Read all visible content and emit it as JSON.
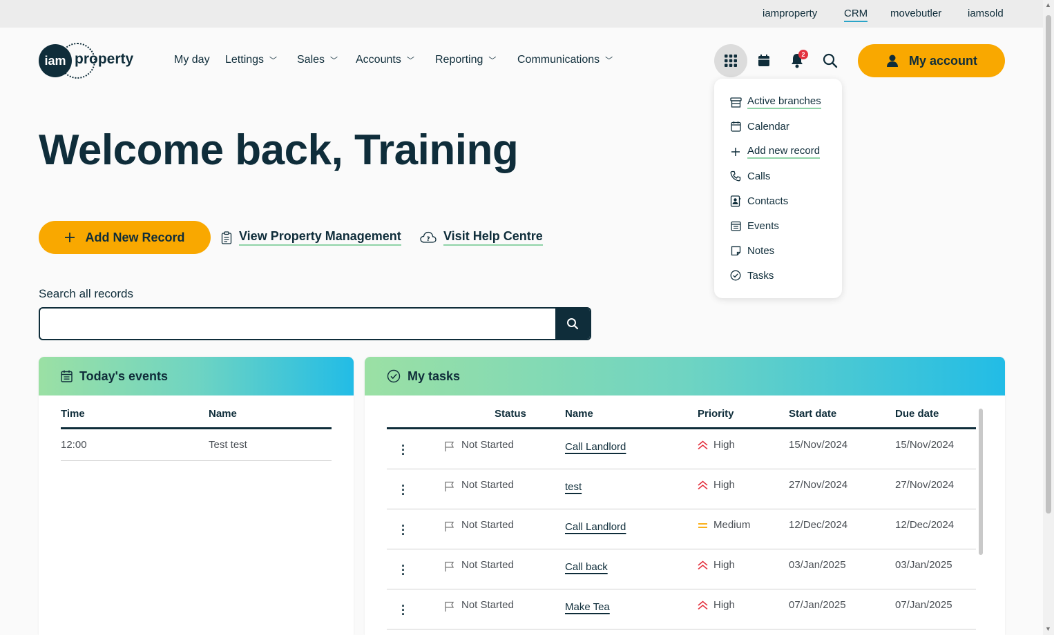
{
  "topbar": {
    "links": [
      "iamproperty",
      "CRM",
      "movebutler",
      "iamsold"
    ],
    "active": "CRM"
  },
  "brand": {
    "logo_circle": "iam",
    "logo_word": "property"
  },
  "nav": {
    "my_day": "My day",
    "lettings": "Lettings",
    "sales": "Sales",
    "accounts": "Accounts",
    "reporting": "Reporting",
    "communications": "Communications"
  },
  "header_icons": {
    "apps": "grid-icon",
    "calendar": "calendar-icon",
    "notifications": "bell-icon",
    "notification_count": "2",
    "search": "search-icon"
  },
  "account_button": "My account",
  "dropdown": {
    "items": [
      {
        "label": "Active branches",
        "icon": "branch-icon"
      },
      {
        "label": "Calendar",
        "icon": "calendar-icon"
      },
      {
        "label": "Add new record",
        "icon": "plus-icon"
      },
      {
        "label": "Calls",
        "icon": "phone-icon"
      },
      {
        "label": "Contacts",
        "icon": "contact-icon"
      },
      {
        "label": "Events",
        "icon": "events-icon"
      },
      {
        "label": "Notes",
        "icon": "note-icon"
      },
      {
        "label": "Tasks",
        "icon": "check-circle-icon"
      }
    ]
  },
  "welcome": "Welcome back, Training",
  "actions": {
    "add_new_record": "Add New Record",
    "view_property_management": "View Property Management",
    "visit_help_centre": "Visit Help Centre"
  },
  "search": {
    "label": "Search all records",
    "value": "",
    "placeholder": ""
  },
  "events": {
    "title": "Today's events",
    "columns": [
      "Time",
      "Name"
    ],
    "rows": [
      {
        "time": "12:00",
        "name": "Test test"
      }
    ]
  },
  "tasks": {
    "title": "My tasks",
    "columns": [
      "Status",
      "Name",
      "Priority",
      "Start date",
      "Due date"
    ],
    "rows": [
      {
        "status": "Not Started",
        "name": "Call Landlord",
        "priority": "High",
        "start": "15/Nov/2024",
        "due": "15/Nov/2024"
      },
      {
        "status": "Not Started",
        "name": "test",
        "priority": "High",
        "start": "27/Nov/2024",
        "due": "27/Nov/2024"
      },
      {
        "status": "Not Started",
        "name": "Call Landlord",
        "priority": "Medium",
        "start": "12/Dec/2024",
        "due": "12/Dec/2024"
      },
      {
        "status": "Not Started",
        "name": "Call back",
        "priority": "High",
        "start": "03/Jan/2025",
        "due": "03/Jan/2025"
      },
      {
        "status": "Not Started",
        "name": "Make Tea",
        "priority": "High",
        "start": "07/Jan/2025",
        "due": "07/Jan/2025"
      }
    ]
  },
  "colors": {
    "brand_dark": "#0f2d3a",
    "accent_orange": "#f9a800",
    "priority_high": "#e3323f",
    "priority_medium": "#f9a800",
    "notification_badge": "#e3323f"
  }
}
